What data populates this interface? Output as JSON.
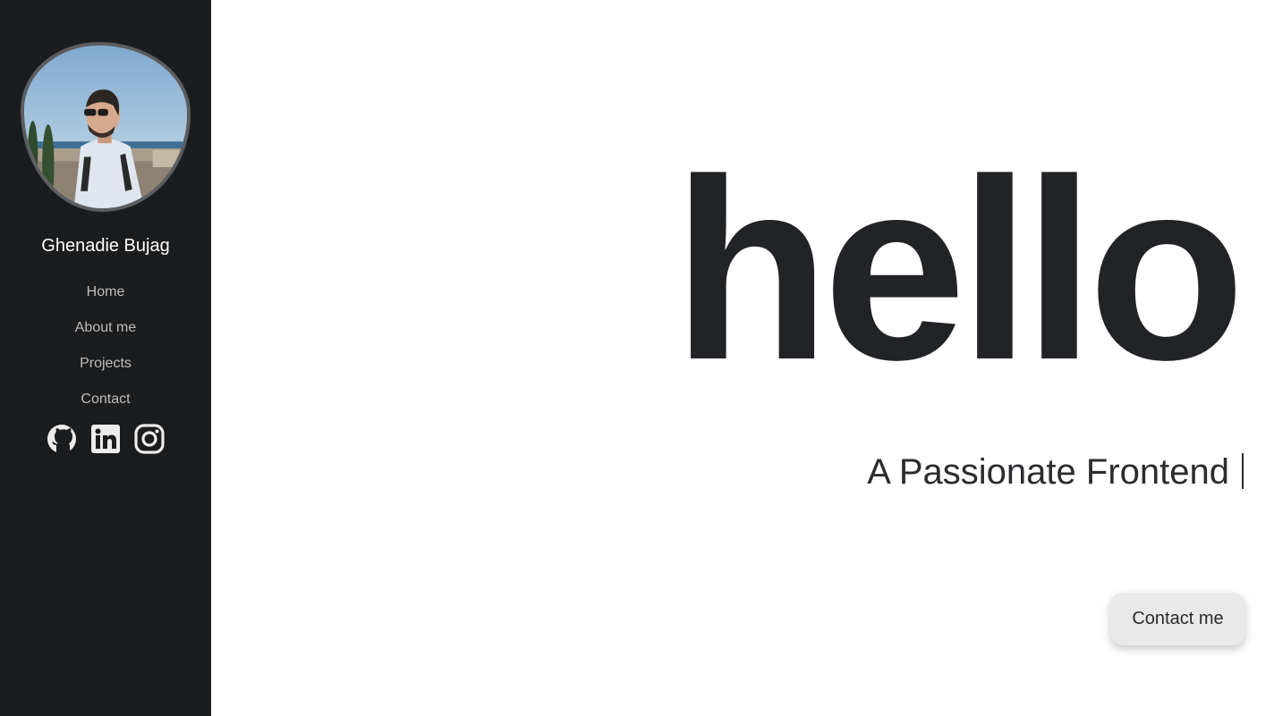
{
  "sidebar": {
    "owner_name": "Ghenadie Bujag",
    "avatar_icon": "profile-photo",
    "nav": [
      {
        "label": "Home"
      },
      {
        "label": "About me"
      },
      {
        "label": "Projects"
      },
      {
        "label": "Contact"
      }
    ],
    "socials": [
      {
        "icon": "github-icon"
      },
      {
        "icon": "linkedin-icon"
      },
      {
        "icon": "instagram-icon"
      }
    ]
  },
  "hero": {
    "title": "hello",
    "subtitle": "A Passionate Frontend"
  },
  "contact_button": {
    "label": "Contact me"
  },
  "colors": {
    "sidebar_bg": "#1b1c1e",
    "page_bg": "#ffffff",
    "title_text": "#212327",
    "button_bg": "#e9e9e9"
  }
}
